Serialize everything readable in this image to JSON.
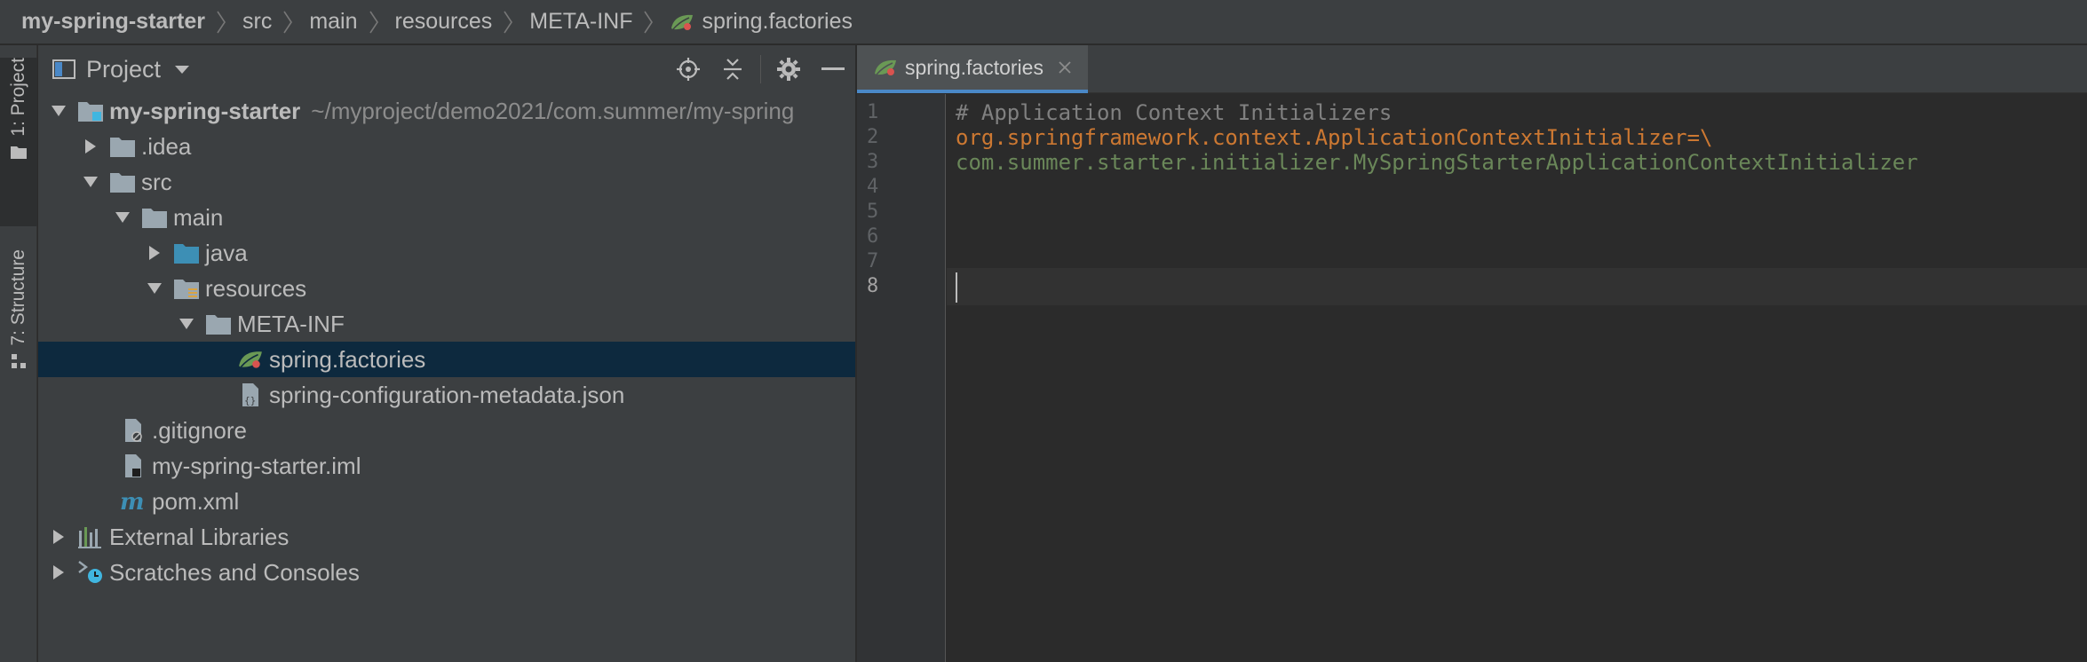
{
  "breadcrumb": {
    "items": [
      "my-spring-starter",
      "src",
      "main",
      "resources",
      "META-INF",
      "spring.factories"
    ]
  },
  "stripe": {
    "project_label": "1: Project",
    "structure_label": "7: Structure"
  },
  "project_panel": {
    "title": "Project",
    "tools": [
      "locate-icon",
      "collapse-all-icon",
      "gear-icon",
      "minimize-icon"
    ],
    "tree": [
      {
        "label": "my-spring-starter",
        "path": "~/myproject/demo2021/com.summer/my-spring",
        "icon": "module-folder-icon",
        "expanded": true
      },
      {
        "label": ".idea",
        "icon": "folder-icon",
        "expanded": false
      },
      {
        "label": "src",
        "icon": "folder-icon",
        "expanded": true
      },
      {
        "label": "main",
        "icon": "folder-icon",
        "expanded": true
      },
      {
        "label": "java",
        "icon": "source-folder-icon",
        "expanded": false
      },
      {
        "label": "resources",
        "icon": "resources-folder-icon",
        "expanded": true
      },
      {
        "label": "META-INF",
        "icon": "folder-icon",
        "expanded": true
      },
      {
        "label": "spring.factories",
        "icon": "spring-leaf-icon",
        "selected": true
      },
      {
        "label": "spring-configuration-metadata.json",
        "icon": "json-file-icon"
      },
      {
        "label": ".gitignore",
        "icon": "ignore-file-icon"
      },
      {
        "label": "my-spring-starter.iml",
        "icon": "iml-file-icon"
      },
      {
        "label": "pom.xml",
        "icon": "maven-icon"
      },
      {
        "label": "External Libraries",
        "icon": "libraries-icon",
        "expanded": false
      },
      {
        "label": "Scratches and Consoles",
        "icon": "scratches-icon",
        "expanded": false
      }
    ]
  },
  "editor": {
    "tab_label": "spring.factories",
    "line_numbers": [
      "1",
      "2",
      "3",
      "4",
      "5",
      "6",
      "7",
      "8"
    ],
    "current_line": 8,
    "lines": {
      "l1": "# Application Context Initializers",
      "l2_key": "org.springframework.context.ApplicationContextInitializer",
      "l2_op": "=\\",
      "l3": "com.summer.starter.initializer.MySpringStarterApplicationContextInitializer"
    }
  },
  "colors": {
    "accent": "#4a88c7",
    "selection": "#0d293e",
    "keyword_orange": "#cc7832",
    "value_green": "#6a8759",
    "comment_gray": "#808080"
  }
}
